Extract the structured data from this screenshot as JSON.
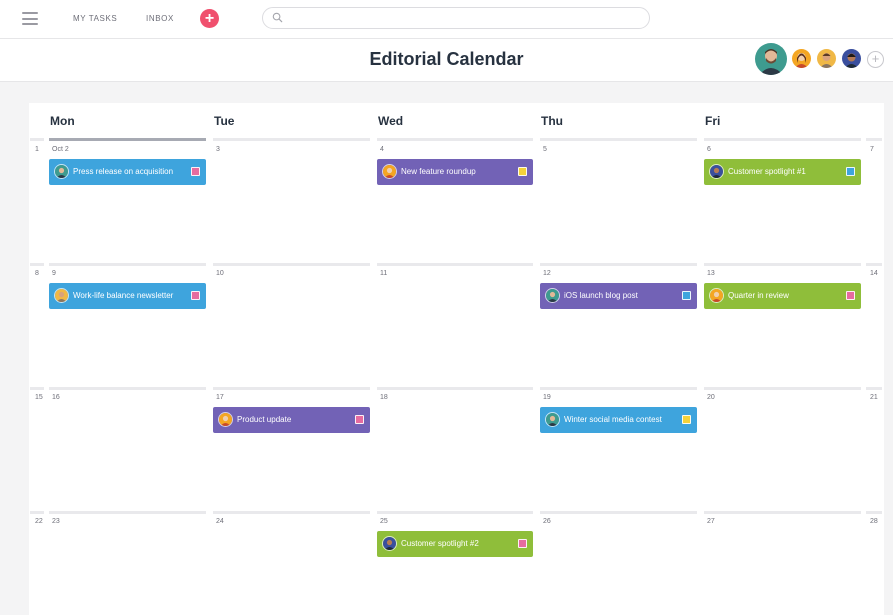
{
  "topbar": {
    "nav": [
      "MY TASKS",
      "INBOX"
    ],
    "add_label": "+",
    "search": {
      "value": "",
      "placeholder": ""
    },
    "icons": {
      "menu": "hamburger-icon",
      "search": "search-icon",
      "add": "plus-icon"
    }
  },
  "header": {
    "title": "Editorial Calendar",
    "add_member_label": "+"
  },
  "calendar": {
    "days": [
      "Mon",
      "Tue",
      "Wed",
      "Thu",
      "Fri"
    ],
    "weeks": [
      {
        "weekend_start": "1",
        "dates": [
          "Oct 2",
          "3",
          "4",
          "5",
          "6"
        ],
        "weekend_end": "7"
      },
      {
        "weekend_start": "8",
        "dates": [
          "9",
          "10",
          "11",
          "12",
          "13"
        ],
        "weekend_end": "14"
      },
      {
        "weekend_start": "15",
        "dates": [
          "16",
          "17",
          "18",
          "19",
          "20"
        ],
        "weekend_end": "21"
      },
      {
        "weekend_start": "22",
        "dates": [
          "23",
          "24",
          "25",
          "26",
          "27"
        ],
        "weekend_end": "28"
      }
    ],
    "events": [
      {
        "title": "Press release on acquisition",
        "color": "#3ea4dd",
        "tag_color": "#e66ba0"
      },
      {
        "title": "New feature roundup",
        "color": "#7262b6",
        "tag_color": "#f4d23a"
      },
      {
        "title": "Customer spotlight #1",
        "color": "#8fbe3a",
        "tag_color": "#3ea4dd"
      },
      {
        "title": "Work-life balance newsletter",
        "color": "#3ea4dd",
        "tag_color": "#e66ba0"
      },
      {
        "title": "iOS launch blog post",
        "color": "#7262b6",
        "tag_color": "#3ea4dd"
      },
      {
        "title": "Quarter in review",
        "color": "#8fbe3a",
        "tag_color": "#e66ba0"
      },
      {
        "title": "Product update",
        "color": "#7262b6",
        "tag_color": "#e66ba0"
      },
      {
        "title": "Winter social media contest",
        "color": "#3ea4dd",
        "tag_color": "#f4d23a"
      },
      {
        "title": "Customer spotlight #2",
        "color": "#8fbe3a",
        "tag_color": "#e66ba0"
      }
    ]
  }
}
